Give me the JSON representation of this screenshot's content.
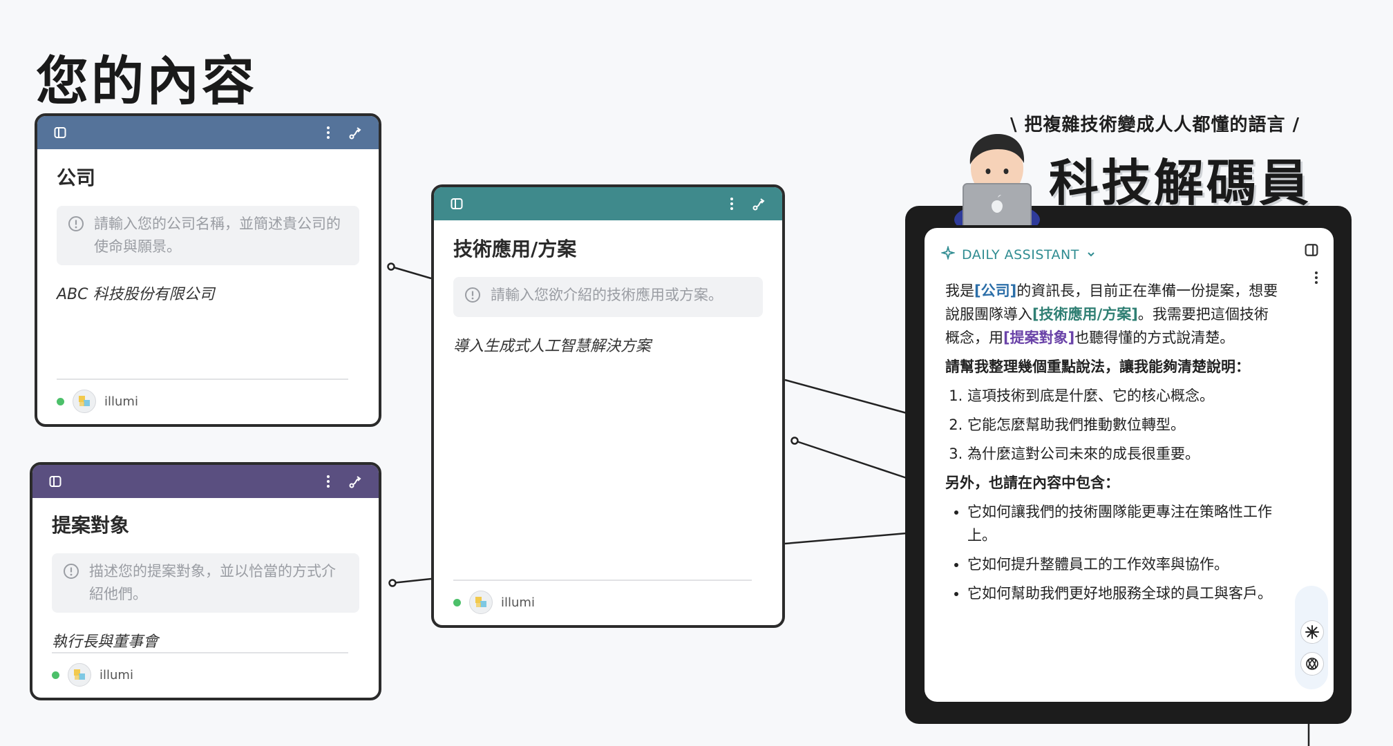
{
  "page": {
    "title": "您的內容"
  },
  "cards": {
    "company": {
      "color": "#55739a",
      "title": "公司",
      "hint": "請輸入您的公司名稱，並簡述貴公司的使命與願景。",
      "value": "ABC 科技股份有限公司",
      "user": "illumi"
    },
    "tech": {
      "color": "#3f8a8c",
      "title": "技術應用/方案",
      "hint": "請輸入您欲介紹的技術應用或方案。",
      "value": "導入生成式人工智慧解決方案",
      "user": "illumi"
    },
    "audience": {
      "color": "#5a4f80",
      "title": "提案對象",
      "hint": "描述您的提案對象，並以恰當的方式介紹他們。",
      "value": "執行長與董事會",
      "user": "illumi"
    }
  },
  "brand": {
    "tagline": "\\ 把複雜技術變成人人都懂的語言 /",
    "name": "科技解碼員"
  },
  "assistant": {
    "label": "DAILY ASSISTANT",
    "prompt": {
      "p1_a": "我是",
      "var_company": "[公司]",
      "p1_b": "的資訊長，目前正在準備一份提案，想要說服團隊導入",
      "var_tech": "[技術應用/方案]",
      "p1_c": "。我需要把這個技術概念，用",
      "var_audience": "[提案對象]",
      "p1_d": "也聽得懂的方式說清楚。",
      "heading1": "請幫我整理幾個重點說法，讓我能夠清楚說明：",
      "steps": [
        "這項技術到底是什麼、它的核心概念。",
        "它能怎麼幫助我們推動數位轉型。",
        "為什麼這對公司未來的成長很重要。"
      ],
      "heading2": "另外，也請在內容中包含：",
      "points": [
        "它如何讓我們的技術團隊能更專注在策略性工作上。",
        "它如何提升整體員工的工作效率與協作。",
        "它如何幫助我們更好地服務全球的員工與客戶。"
      ]
    },
    "accent": "#2f8c91"
  }
}
